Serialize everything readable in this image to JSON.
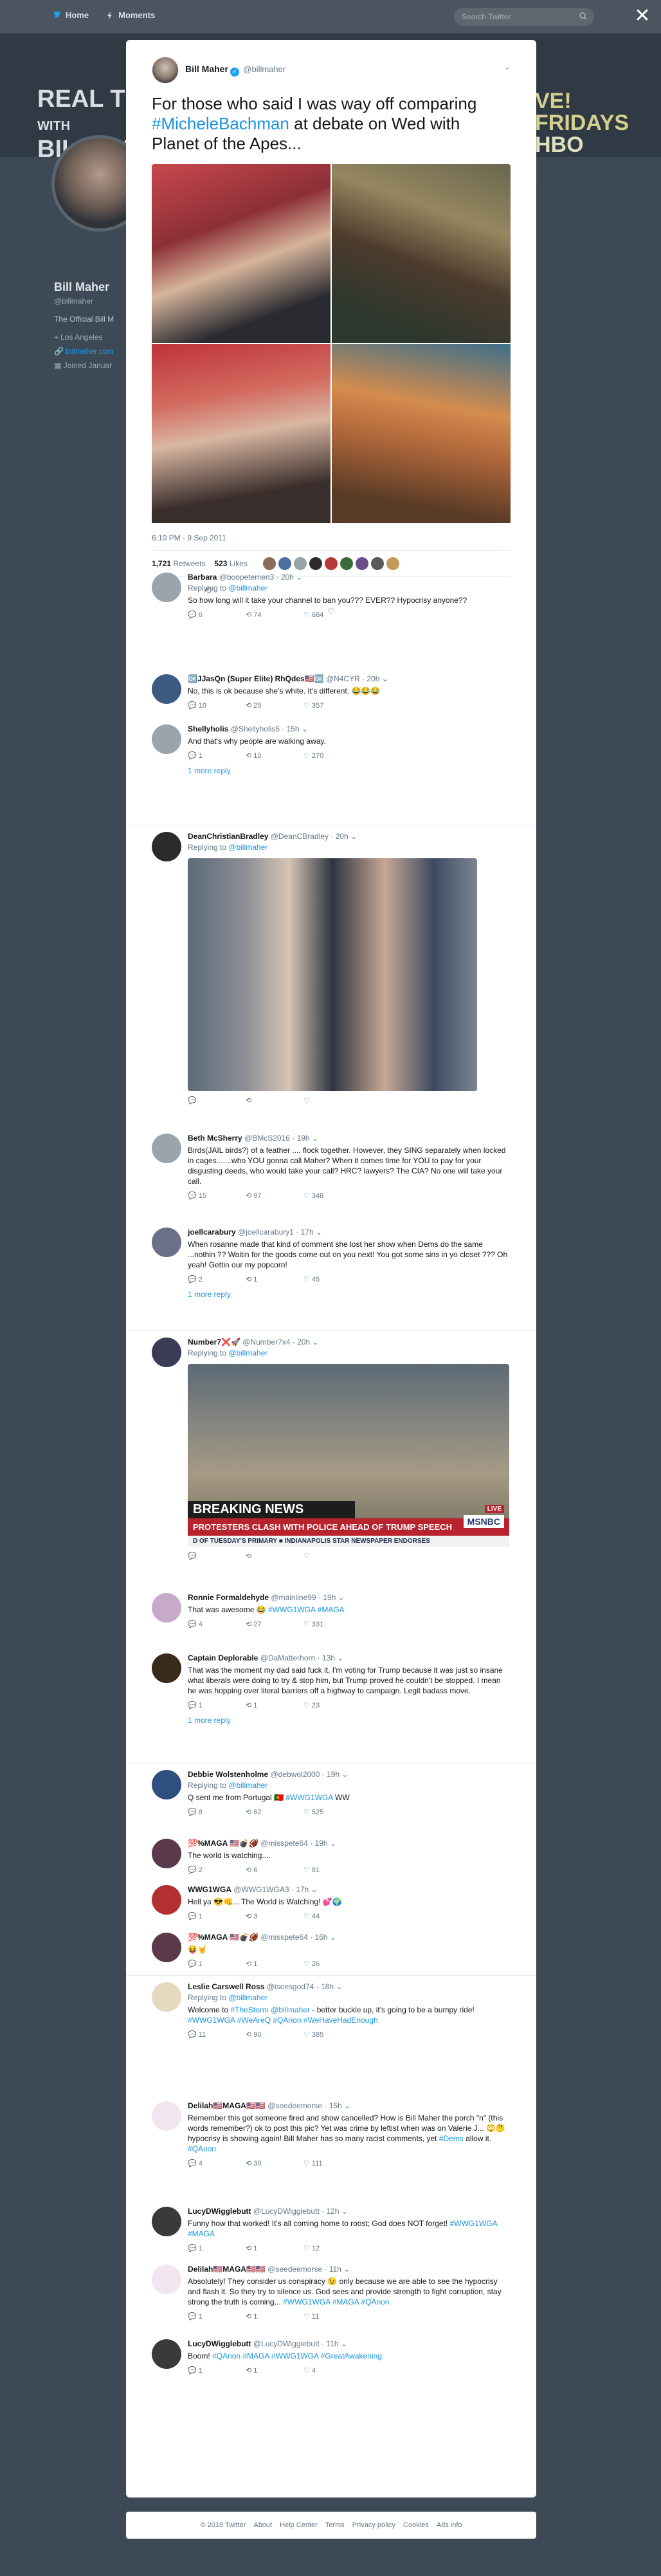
{
  "nav": {
    "home": "Home",
    "moments": "Moments",
    "search_placeholder": "Search Twitter"
  },
  "banner": {
    "left": "REAL TIME\nWITH\nBILL MAHER",
    "right": "VE! FRIDAYS\nHBO"
  },
  "profile": {
    "name": "Bill Maher",
    "handle": "@billmaher",
    "bio": "The Official Bill M",
    "location": "Los Angeles",
    "url": "billmaher.com",
    "joined": "Joined Januar"
  },
  "tweet": {
    "name": "Bill Maher",
    "handle": "@billmaher",
    "text_pre": "For those who said I was way off comparing ",
    "hashtag": "#MicheleBachman",
    "text_post": " at debate on Wed with Planet of the Apes...",
    "time": "6:10 PM - 9 Sep 2011",
    "retweets_count": "1,721",
    "retweets_label": "Retweets",
    "likes_count": "523",
    "likes_label": "Likes"
  },
  "replies": [
    {
      "name": "Barbara",
      "handle": "@boopetemen3",
      "time": "20h",
      "replying": "Replying to ",
      "to": "@billmaher",
      "text": "So how long will it take your channel to ban you??? EVER?? Hypocrisy anyone??",
      "reply": "6",
      "rt": "74",
      "like": "684"
    },
    {
      "name": "🆗JJasQn (Super Elite) RhQdes🇺🇸🆗",
      "handle": "@N4CYR",
      "time": "20h",
      "text": "No, this is ok because she's white. It's different. 😂😂😂",
      "reply": "10",
      "rt": "25",
      "like": "357"
    },
    {
      "name": "Shellyholis",
      "handle": "@Shellyholis5",
      "time": "15h",
      "text": "And that's why people are walking away.",
      "reply": "1",
      "rt": "10",
      "like": "270",
      "more": "1 more reply"
    },
    {
      "name": "DeanChristianBradley",
      "handle": "@DeanCBradley",
      "time": "20h",
      "replying": "Replying to ",
      "to": "@billmaher"
    },
    {
      "name": "Beth McSherry",
      "handle": "@BMcS2016",
      "time": "19h",
      "text": "Birds(JAIL birds?) of a feather .... flock together. However, they SING separately when locked in cages.......who YOU gonna call Maher? When it comes time for YOU to pay for your disgusting deeds, who would take your call? HRC? lawyers? The CIA? No one will take your call.",
      "reply": "15",
      "rt": "97",
      "like": "348"
    },
    {
      "name": "joellcarabury",
      "handle": "@joellcarabury1",
      "time": "17h",
      "text": "When rosanne made that kind of comment she lost her show when Dems do the same ...nothin ?? Waitin for the goods come out on you next! You got some sins in yo closet ??? Oh yeah! Gettin our my popcorn!",
      "reply": "2",
      "rt": "1",
      "like": "45",
      "more": "1 more reply"
    },
    {
      "name": "Number7❌🚀",
      "handle": "@Number7x4",
      "time": "20h",
      "replying": "Replying to ",
      "to": "@billmaher"
    },
    {
      "name": "Ronnie Formaldehyde",
      "handle": "@mainline99",
      "time": "19h",
      "text": "That was awesome 😂 ",
      "tags": "#WWG1WGA #MAGA",
      "reply": "4",
      "rt": "27",
      "like": "331"
    },
    {
      "name": "Captain Deplorable",
      "handle": "@DaMatterhorn",
      "time": "13h",
      "text": "That was the moment my dad said fuck it, I'm voting for Trump because it was just so insane what liberals were doing to try & stop him, but Trump proved he couldn't be stopped. I mean he was hopping over literal barriers off a highway to campaign. Legit badass move.",
      "reply": "1",
      "rt": "1",
      "like": "23",
      "more": "1 more reply"
    },
    {
      "name": "Debbie Wolstenholme",
      "handle": "@debwol2000",
      "time": "19h",
      "replying": "Replying to ",
      "to": "@billmaher",
      "text": "Q sent me from Portugal 🇵🇹 ",
      "tags": "#WWG1WGA",
      "text2": " WW",
      "reply": "8",
      "rt": "62",
      "like": "525"
    },
    {
      "name": "💯%MAGA 🇺🇸💣🏈",
      "handle": "@misspete64",
      "time": "19h",
      "text": "The world is watching....",
      "reply": "2",
      "rt": "6",
      "like": "81"
    },
    {
      "name": "WWG1WGA",
      "handle": "@WWG1WGA3",
      "time": "17h",
      "text": "Hell ya 😎👊... The World is Watching! 💕🌍",
      "reply": "1",
      "rt": "3",
      "like": "44"
    },
    {
      "name": "💯%MAGA 🇺🇸💣🏈",
      "handle": "@misspete64",
      "time": "16h",
      "text": "😝🤘",
      "reply": "1",
      "rt": "1",
      "like": "26"
    },
    {
      "name": "Leslie Carswell Ross",
      "handle": "@iseesgod74",
      "time": "18h",
      "replying": "Replying to ",
      "to": "@billmaher",
      "text": "Welcome to ",
      "tags": "#TheStorm @billmaher",
      "text2": " - better buckle up, it's going to be a bumpy ride!",
      "tags2": "#WWG1WGA #WeAreQ #QAnon #WeHaveHadEnough",
      "reply": "11",
      "rt": "90",
      "like": "385"
    },
    {
      "name": "Delilah🇺🇸MAGA🇺🇸🇺🇸",
      "handle": "@seedeemorse",
      "time": "15h",
      "text": "Remember this got someone fired and show cancelled? How is Bill Maher the porch \"n\" (this words remember?) ok to post this pic? Yet was crime by leftist when was on Valerie J... 😳🤔 hypocrisy is showing again! Bill Maher has so many racist comments, yet ",
      "tags": "#Dems",
      "text2": " allow it. ",
      "tags2": "#QAnon",
      "reply": "4",
      "rt": "30",
      "like": "111"
    },
    {
      "name": "LucyDWigglebutt",
      "handle": "@LucyDWigglebutt",
      "time": "12h",
      "text": "Funny how that worked! It's all coming home to roost; God does NOT forget! ",
      "tags": "#WWG1WGA #MAGA",
      "reply": "1",
      "rt": "1",
      "like": "12"
    },
    {
      "name": "Delilah🇺🇸MAGA🇺🇸🇺🇸",
      "handle": "@seedeemorse",
      "time": "11h",
      "text": "Absolutely! They consider us conspiracy 😉 only because we are able to see the hypocrisy and flash it. So they try to silence us. God sees and provide strength to fight corruption, stay strong the truth is coming... ",
      "tags": "#WWG1WGA #MAGA #QAnon",
      "reply": "1",
      "rt": "1",
      "like": "11"
    },
    {
      "name": "LucyDWigglebutt",
      "handle": "@LucyDWigglebutt",
      "time": "11h",
      "text": "Boom! ",
      "tags": "#QAnon #MAGA #WWG1WGA #GreatAwakening",
      "reply": "1",
      "rt": "1",
      "like": "4"
    }
  ],
  "breaking": {
    "headline": "BREAKING NEWS",
    "sub": "PROTESTERS CLASH WITH POLICE AHEAD OF TRUMP SPEECH",
    "network": "MSNBC",
    "live": "LIVE",
    "ticker": "D OF TUESDAY'S PRIMARY  ■ INDIANAPOLIS STAR NEWSPAPER ENDORSES"
  },
  "footer": [
    "© 2018 Twitter",
    "About",
    "Help Center",
    "Terms",
    "Privacy policy",
    "Cookies",
    "Ads info"
  ]
}
